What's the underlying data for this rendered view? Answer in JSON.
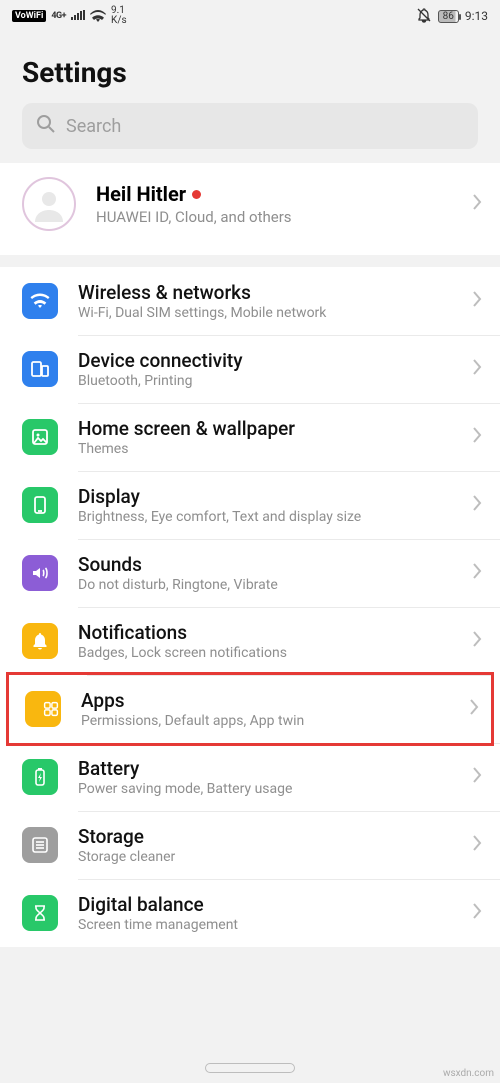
{
  "status": {
    "vowifi": "VoWiFi",
    "net_label": "4G+",
    "speed_top": "9.1",
    "speed_bot": "K/s",
    "battery": "86",
    "time": "9:13"
  },
  "title": "Settings",
  "search": {
    "placeholder": "Search"
  },
  "account": {
    "name": "Heil Hitler",
    "sub": "HUAWEI ID, Cloud, and others"
  },
  "rows": {
    "wireless": {
      "title": "Wireless & networks",
      "sub": "Wi-Fi, Dual SIM settings, Mobile network"
    },
    "device": {
      "title": "Device connectivity",
      "sub": "Bluetooth, Printing"
    },
    "home": {
      "title": "Home screen & wallpaper",
      "sub": "Themes"
    },
    "display": {
      "title": "Display",
      "sub": "Brightness, Eye comfort, Text and display size"
    },
    "sounds": {
      "title": "Sounds",
      "sub": "Do not disturb, Ringtone, Vibrate"
    },
    "notifications": {
      "title": "Notifications",
      "sub": "Badges, Lock screen notifications"
    },
    "apps": {
      "title": "Apps",
      "sub": "Permissions, Default apps, App twin"
    },
    "battery": {
      "title": "Battery",
      "sub": "Power saving mode, Battery usage"
    },
    "storage": {
      "title": "Storage",
      "sub": "Storage cleaner"
    },
    "digital": {
      "title": "Digital balance",
      "sub": "Screen time management"
    }
  },
  "watermark": "wsxdn.com"
}
